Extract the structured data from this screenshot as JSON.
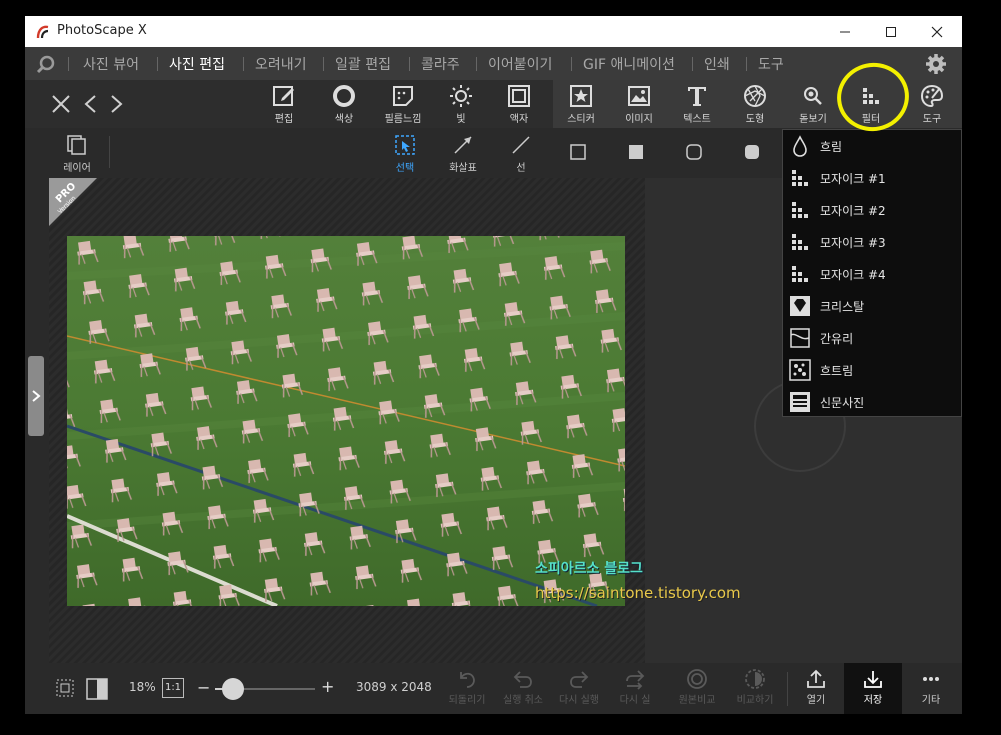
{
  "window": {
    "title": "PhotoScape X"
  },
  "menu": [
    {
      "label": "사진 뷰어",
      "active": false
    },
    {
      "label": "사진 편집",
      "active": true
    },
    {
      "label": "오려내기",
      "active": false
    },
    {
      "label": "일괄 편집",
      "active": false
    },
    {
      "label": "콜라주",
      "active": false
    },
    {
      "label": "이어붙이기",
      "active": false
    },
    {
      "label": "GIF 애니메이션",
      "active": false
    },
    {
      "label": "인쇄",
      "active": false
    },
    {
      "label": "도구",
      "active": false
    }
  ],
  "toolbar": {
    "edit": "편집",
    "color": "색상",
    "film": "필름느낌",
    "light": "빛",
    "frame": "액자",
    "sticker": "스티커",
    "image": "이미지",
    "text": "텍스트",
    "shape": "도형",
    "magnifier": "돋보기",
    "filter": "필터",
    "tools": "도구"
  },
  "subtoolbar": {
    "layer": "레이어",
    "select": "선택",
    "arrow": "화살표",
    "line": "선"
  },
  "badge": {
    "line1": "PRO",
    "line2": "Version"
  },
  "filter_menu": [
    {
      "icon": "drop-icon",
      "label": "흐림"
    },
    {
      "icon": "mosaic-icon",
      "label": "모자이크 #1"
    },
    {
      "icon": "mosaic-icon",
      "label": "모자이크 #2"
    },
    {
      "icon": "mosaic-icon",
      "label": "모자이크 #3"
    },
    {
      "icon": "mosaic-icon",
      "label": "모자이크 #4"
    },
    {
      "icon": "crystal-icon",
      "label": "크리스탈"
    },
    {
      "icon": "frosted-glass-icon",
      "label": "간유리"
    },
    {
      "icon": "scatter-icon",
      "label": "흐트림"
    },
    {
      "icon": "newspaper-icon",
      "label": "신문사진"
    }
  ],
  "watermark": {
    "title": "소피아르소 블로그",
    "url": "https://saintone.tistory.com"
  },
  "bottombar": {
    "zoom": "18%",
    "zoom_level": 0.18,
    "one_to_one": "1:1",
    "minus": "−",
    "plus": "+",
    "image_size": "3089 x 2048",
    "revert": "되돌리기",
    "undo": "실행 취소",
    "redo": "다시 실행",
    "redo_all": "다시 실",
    "original": "원본비교",
    "compare": "비교하기",
    "open": "열기",
    "save": "저장",
    "more": "기타"
  },
  "colors": {
    "accent_blue": "#3ea7ff",
    "highlight": "#f3f000",
    "watermark_title": "#56e0c8",
    "watermark_url": "#e8c84a"
  }
}
